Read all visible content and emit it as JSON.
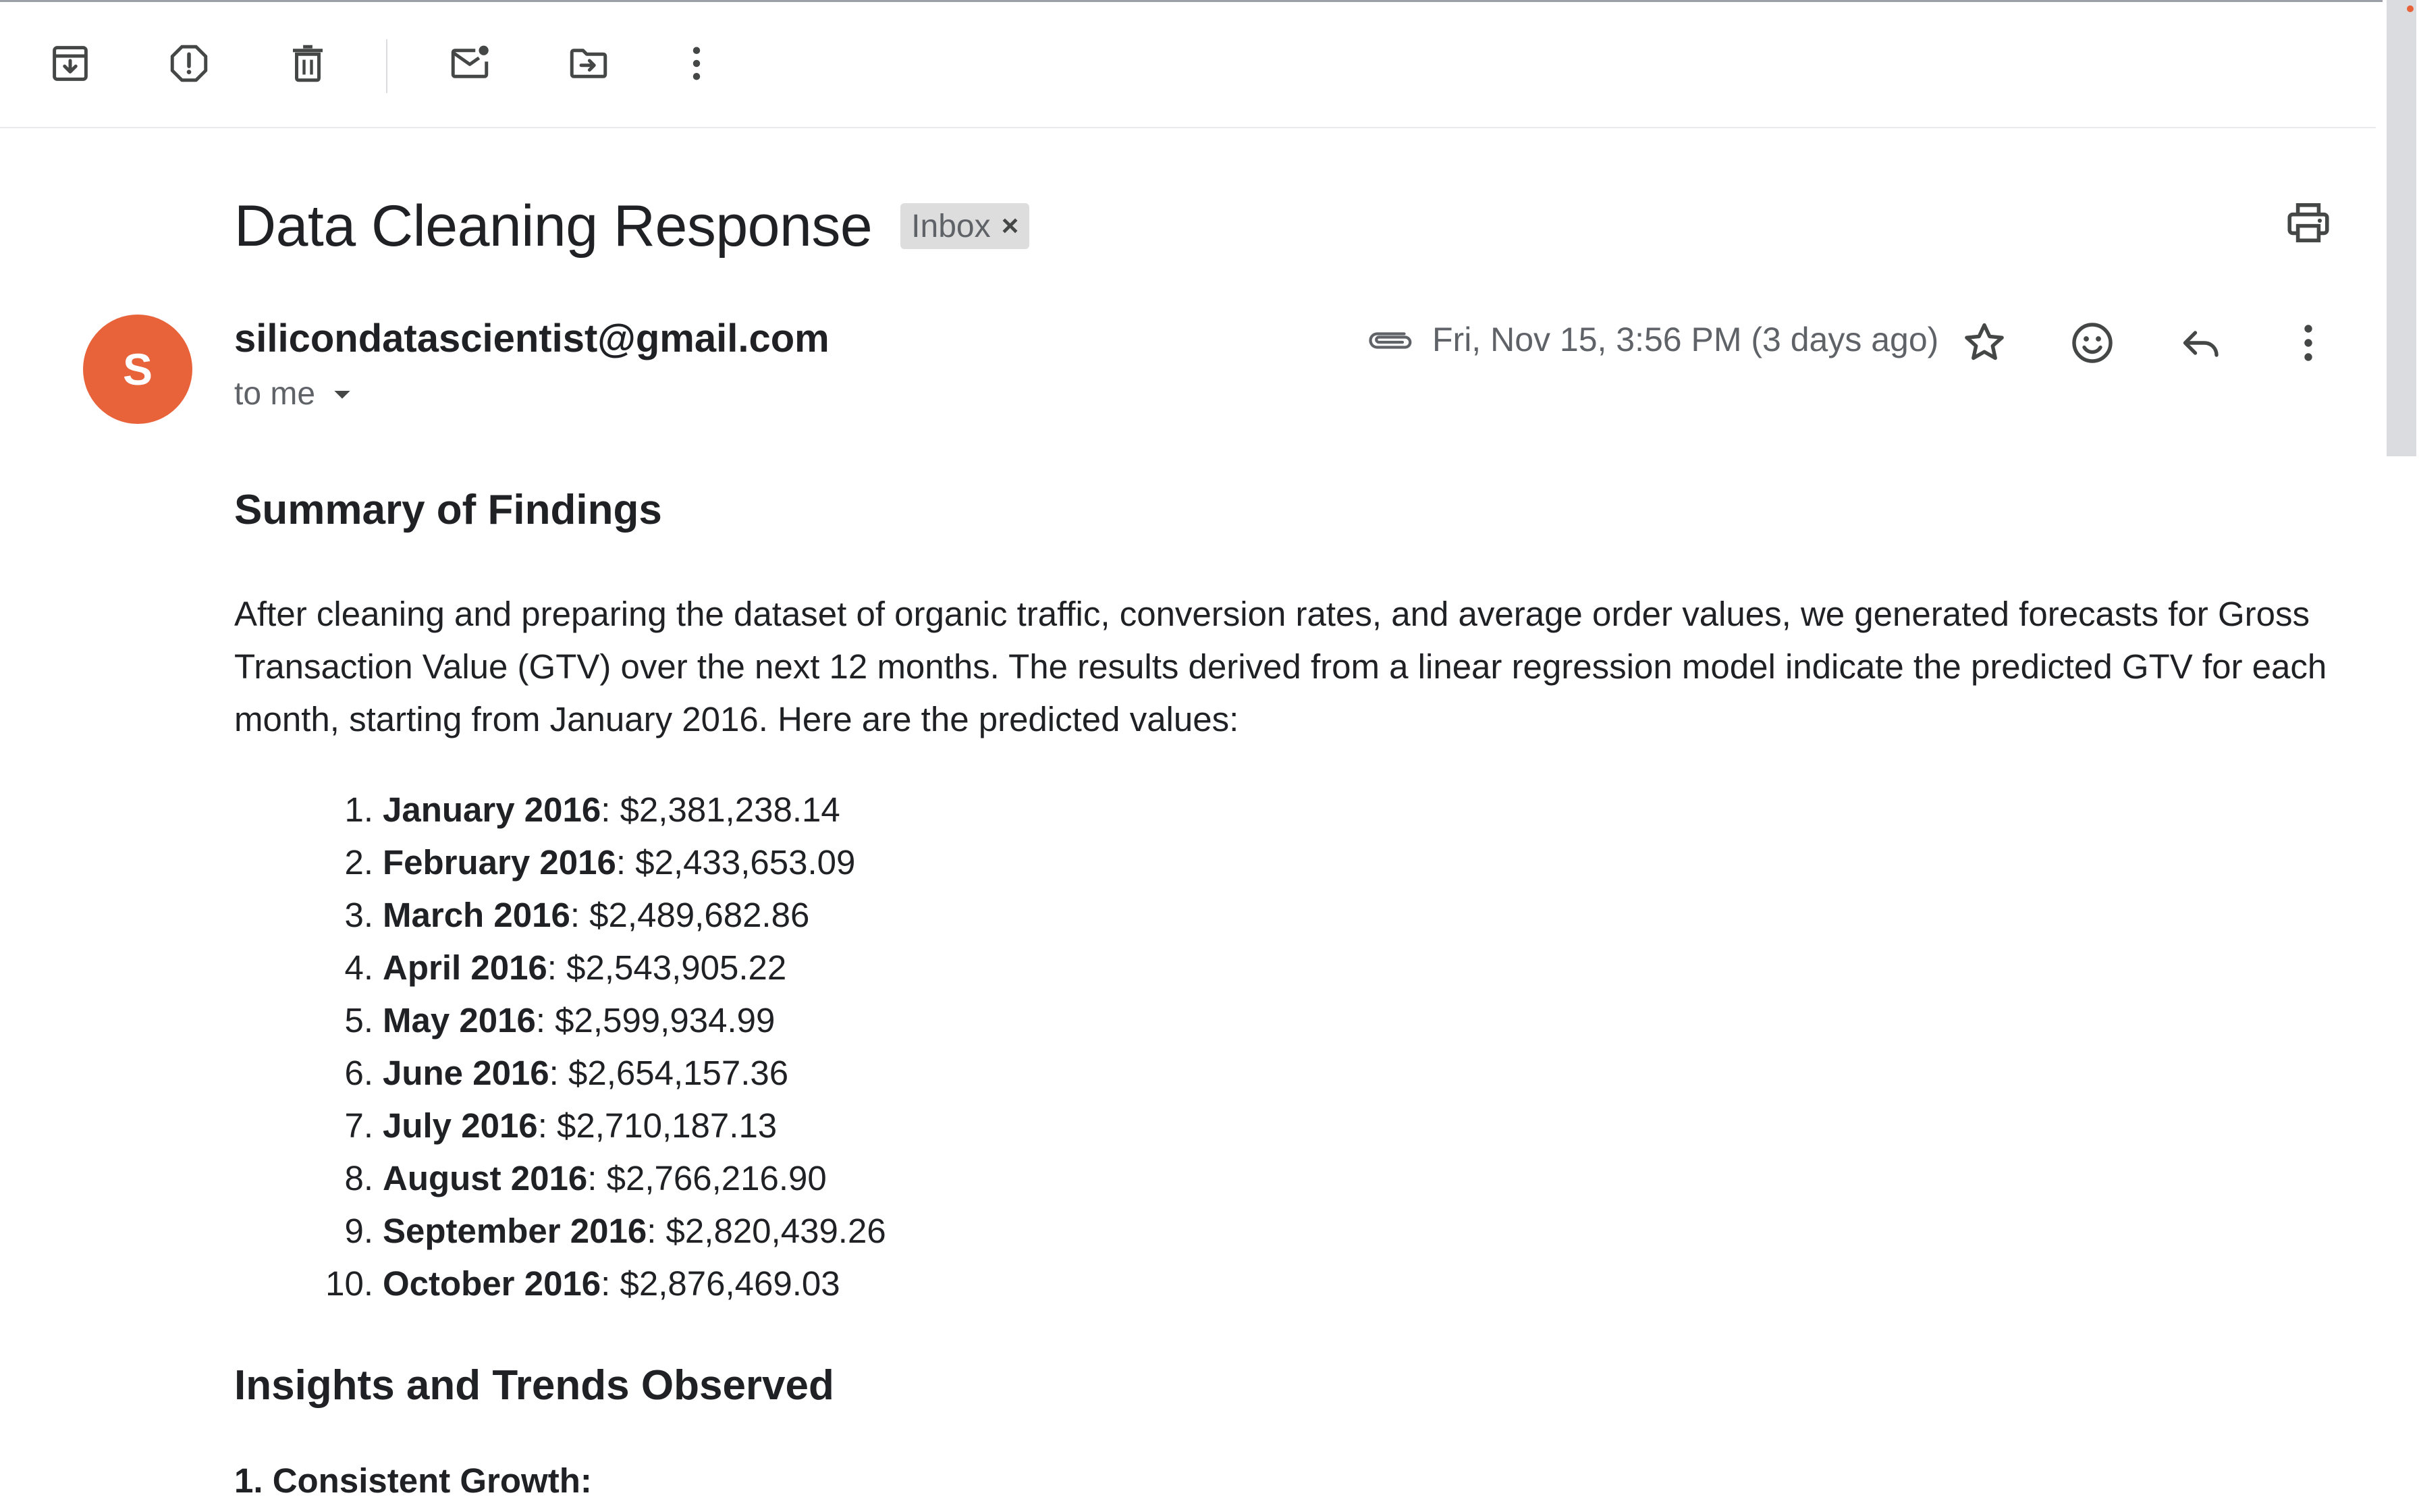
{
  "toolbar": {
    "icons": [
      "archive-icon",
      "report-spam-icon",
      "delete-icon",
      "mark-unread-icon",
      "move-to-icon",
      "more-vert-icon"
    ]
  },
  "email": {
    "subject": "Data Cleaning Response",
    "label": "Inbox",
    "label_close": "×",
    "sender_initial": "S",
    "sender": "silicondatascientist@gmail.com",
    "recipient": "to me",
    "date": "Fri, Nov 15, 3:56 PM (3 days ago)",
    "colors": {
      "avatar": "#e8623a",
      "label_bg": "#dddddd"
    }
  },
  "body": {
    "heading1": "Summary of Findings",
    "intro": "After cleaning and preparing the dataset of organic traffic, conversion rates, and average order values, we generated forecasts for Gross Transaction Value (GTV) over the next 12 months. The results derived from a linear regression model indicate the predicted GTV for each month, starting from January 2016. Here are the predicted values:",
    "forecast": [
      {
        "num": "1.",
        "month": "January 2016",
        "value": ": $2,381,238.14"
      },
      {
        "num": "2.",
        "month": "February 2016",
        "value": ": $2,433,653.09"
      },
      {
        "num": "3.",
        "month": "March 2016",
        "value": ": $2,489,682.86"
      },
      {
        "num": "4.",
        "month": "April 2016",
        "value": ": $2,543,905.22"
      },
      {
        "num": "5.",
        "month": "May 2016",
        "value": ": $2,599,934.99"
      },
      {
        "num": "6.",
        "month": "June 2016",
        "value": ": $2,654,157.36"
      },
      {
        "num": "7.",
        "month": "July 2016",
        "value": ": $2,710,187.13"
      },
      {
        "num": "8.",
        "month": "August 2016",
        "value": ": $2,766,216.90"
      },
      {
        "num": "9.",
        "month": "September 2016",
        "value": ": $2,820,439.26"
      },
      {
        "num": "10.",
        "month": "October 2016",
        "value": ": $2,876,469.03"
      }
    ],
    "heading2": "Insights and Trends Observed",
    "heading3": "1. Consistent Growth:"
  }
}
